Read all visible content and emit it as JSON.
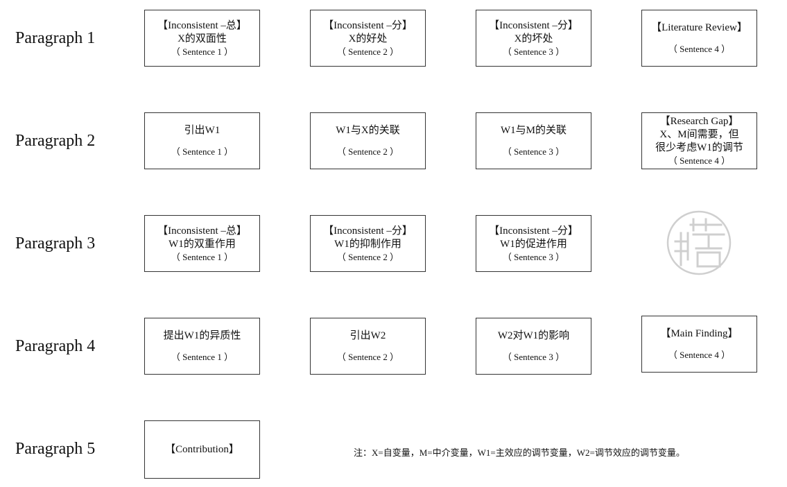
{
  "paragraphs": [
    {
      "label": "Paragraph 1",
      "boxes": [
        {
          "l1": "【Inconsistent –总】",
          "l2": "X的双面性",
          "l3": "（ Sentence 1 ）"
        },
        {
          "l1": "【Inconsistent –分】",
          "l2": "X的好处",
          "l3": "（ Sentence 2 ）"
        },
        {
          "l1": "【Inconsistent –分】",
          "l2": "X的坏处",
          "l3": "（ Sentence 3 ）"
        },
        {
          "l1": "【Literature Review】",
          "l2": "",
          "l3": "（ Sentence 4 ）"
        }
      ]
    },
    {
      "label": "Paragraph 2",
      "boxes": [
        {
          "l1": "引出W1",
          "l2": "",
          "l3": "（ Sentence 1 ）"
        },
        {
          "l1": "W1与X的关联",
          "l2": "",
          "l3": "（ Sentence 2 ）"
        },
        {
          "l1": "W1与M的关联",
          "l2": "",
          "l3": "（ Sentence 3 ）"
        },
        {
          "l1": "【Research Gap】",
          "l2": "X、M间需要，但",
          "l2b": "很少考虑W1的调节",
          "l3": "（ Sentence 4 ）"
        }
      ]
    },
    {
      "label": "Paragraph 3",
      "boxes": [
        {
          "l1": "【Inconsistent –总】",
          "l2": "W1的双重作用",
          "l3": "（ Sentence 1 ）"
        },
        {
          "l1": "【Inconsistent –分】",
          "l2": "W1的抑制作用",
          "l3": "（ Sentence 2 ）"
        },
        {
          "l1": "【Inconsistent –分】",
          "l2": "W1的促进作用",
          "l3": "（ Sentence 3 ）"
        }
      ]
    },
    {
      "label": "Paragraph 4",
      "boxes": [
        {
          "l1": "提出W1的异质性",
          "l2": "",
          "l3": "（ Sentence 1 ）"
        },
        {
          "l1": "引出W2",
          "l2": "",
          "l3": "（ Sentence 2 ）"
        },
        {
          "l1": "W2对W1的影响",
          "l2": "",
          "l3": "（ Sentence 3 ）"
        },
        {
          "l1": "【Main Finding】",
          "l2": "",
          "l3": "（ Sentence 4 ）"
        }
      ]
    },
    {
      "label": "Paragraph 5",
      "boxes": [
        {
          "l1": "【Contribution】",
          "l2": "",
          "l3": ""
        }
      ]
    }
  ],
  "note": "注：X=自变量，M=中介变量，W1=主效应的调节变量，W2=调节效应的调节变量。",
  "watermark": {
    "icon": "seal-watermark-icon",
    "color": "#cfcfcf"
  }
}
